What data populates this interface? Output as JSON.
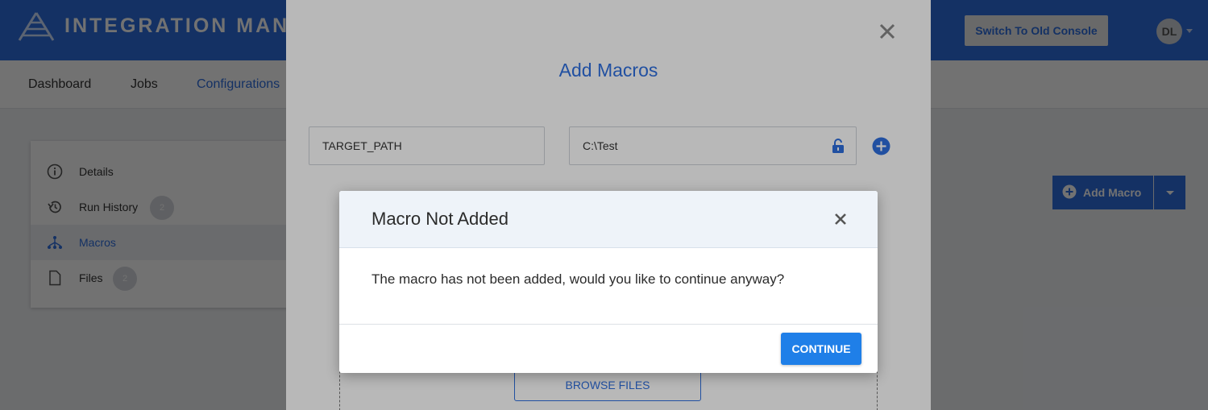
{
  "app": {
    "brand": "INTEGRATION MANA",
    "switch_console_label": "Switch To Old Console",
    "user_initials": "DL"
  },
  "nav": {
    "items": [
      {
        "label": "Dashboard"
      },
      {
        "label": "Jobs"
      },
      {
        "label": "Configurations"
      }
    ]
  },
  "sidebar": {
    "items": [
      {
        "label": "Details",
        "icon": "info-icon"
      },
      {
        "label": "Run History",
        "icon": "history-icon",
        "count": "2"
      },
      {
        "label": "Macros",
        "icon": "macros-icon"
      },
      {
        "label": "Files",
        "icon": "file-icon",
        "count": "2"
      }
    ]
  },
  "toolbar": {
    "add_macro_label": "Add Macro"
  },
  "add_macros_dialog": {
    "title": "Add Macros",
    "name_value": "TARGET_PATH",
    "value_value": "C:\\Test",
    "browse_label": "BROWSE FILES"
  },
  "confirm_dialog": {
    "title": "Macro Not Added",
    "message": "The macro has not been added, would you like to continue anyway?",
    "continue_label": "CONTINUE"
  },
  "colors": {
    "brand_blue": "#2f6fe0",
    "button_blue": "#1f7fe8"
  }
}
